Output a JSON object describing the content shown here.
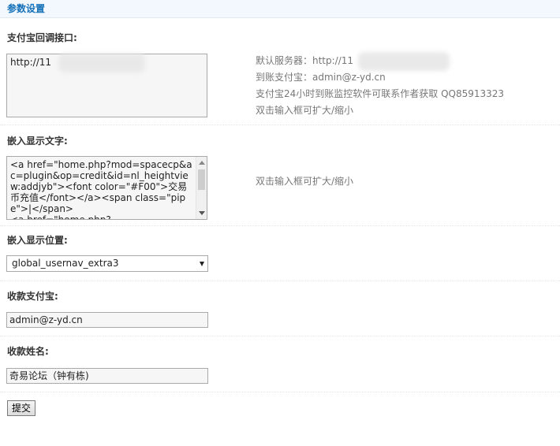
{
  "header": {
    "title": "参数设置"
  },
  "callback": {
    "title": "支付宝回调接口:",
    "value": "http://11",
    "tips": [
      "默认服务器：http://11",
      "到账支付宝：admin@z-yd.cn",
      "支付宝24小时到账监控软件可联系作者获取 QQ85913323",
      "双击输入框可扩大/缩小"
    ]
  },
  "embed_text": {
    "title": "嵌入显示文字:",
    "value": "<a href=\"home.php?mod=spacecp&ac=plugin&op=credit&id=nl_heightview:addjyb\"><font color=\"#F00\">交易币充值</font></a><span class=\"pipe\">|</span>\n<a href=\"home.php?",
    "tip": "双击输入框可扩大/缩小"
  },
  "embed_position": {
    "title": "嵌入显示位置:",
    "selected": "global_usernav_extra3"
  },
  "alipay_account": {
    "title": "收款支付宝:",
    "value": "admin@z-yd.cn"
  },
  "payee_name": {
    "title": "收款姓名:",
    "value": "奇易论坛（钟有栋)"
  },
  "submit": {
    "label": "提交"
  }
}
